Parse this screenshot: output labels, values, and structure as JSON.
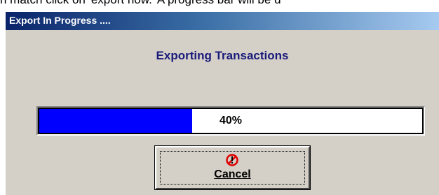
{
  "background_caption": "n match click on 'export now.' A progress bar will be d",
  "dialog": {
    "title": "Export In Progress ....",
    "heading": "Exporting Transactions",
    "progress": {
      "fraction": 0.4,
      "label": "40%",
      "fill_color": "#0000ff"
    },
    "cancel_button": {
      "label": "Cancel",
      "icon": "stop-cancel-icon"
    }
  }
}
